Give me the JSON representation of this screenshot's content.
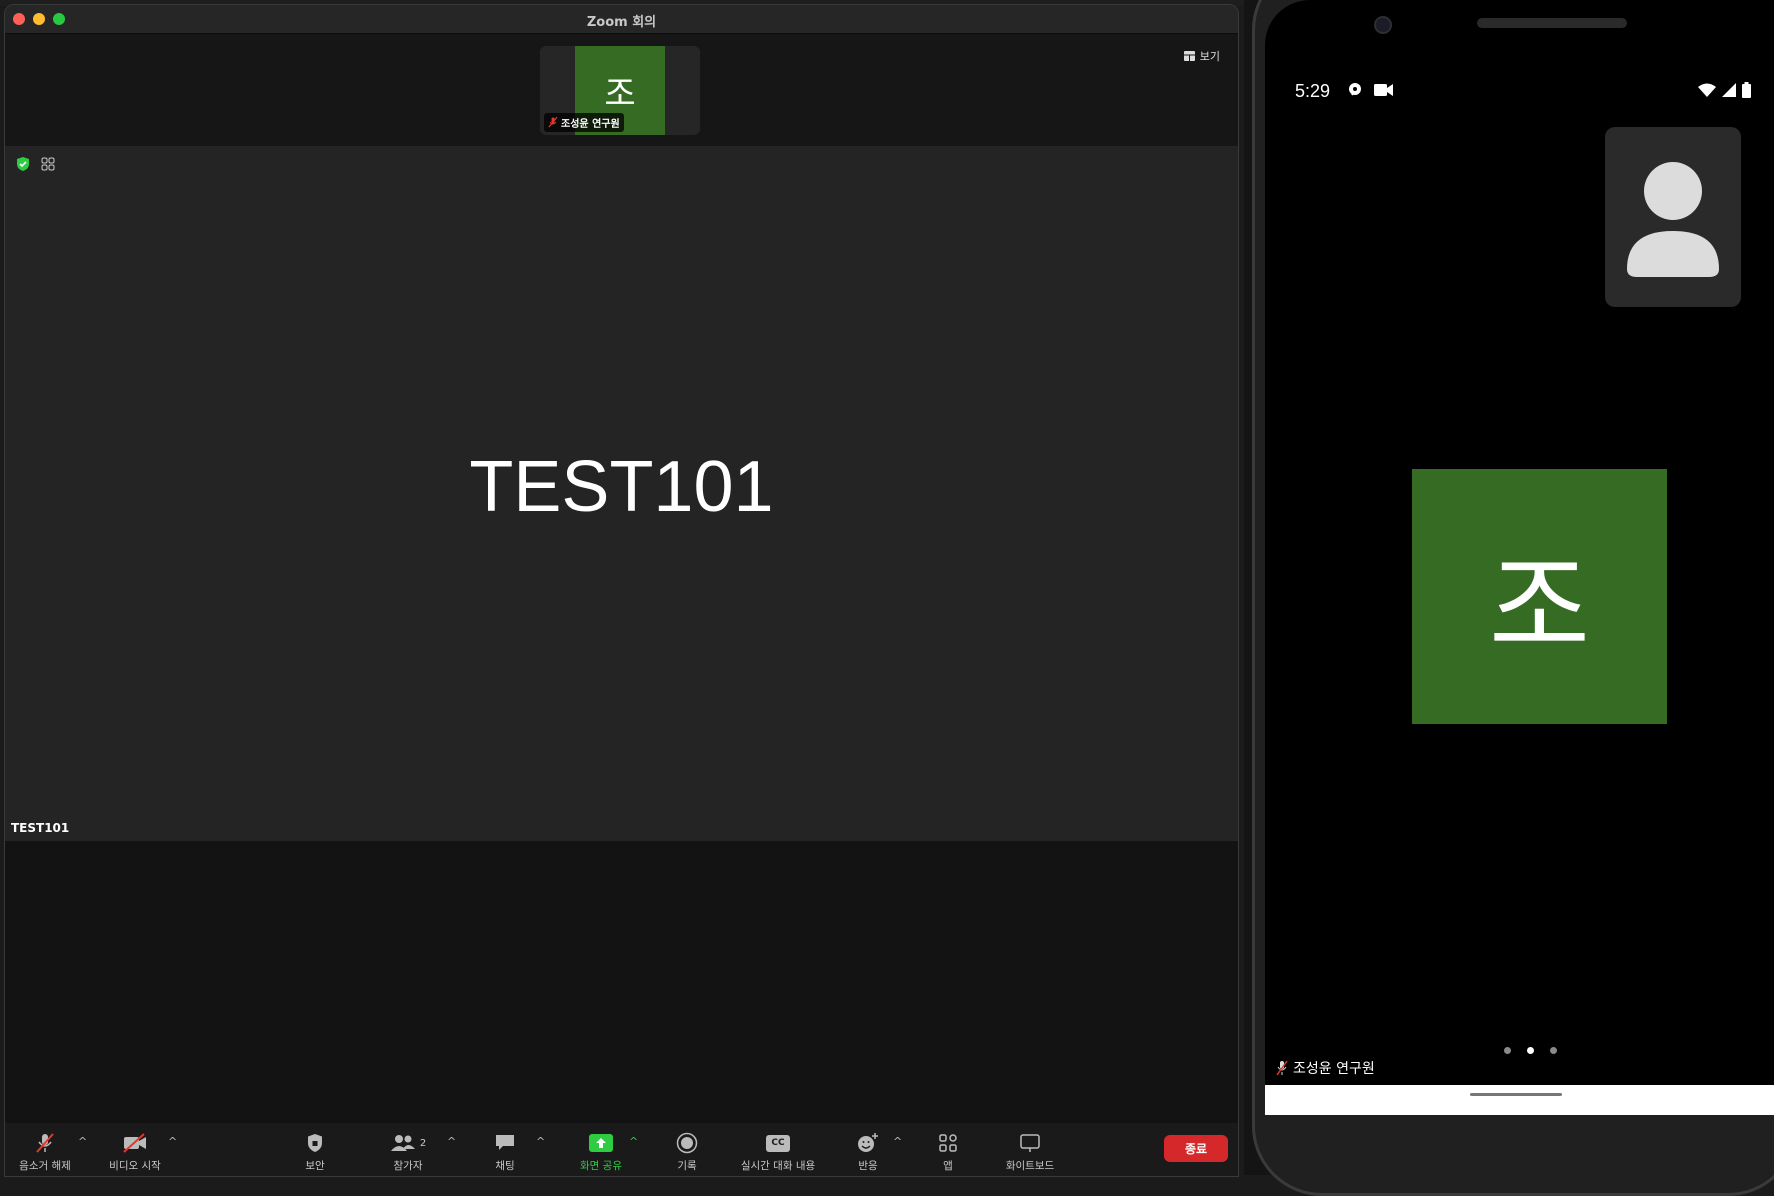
{
  "window": {
    "title": "Zoom 회의"
  },
  "strip": {
    "view_label": "보기",
    "thumbnail": {
      "initial": "조",
      "name": "조성윤 연구원"
    }
  },
  "main": {
    "name": "TEST101",
    "label": "TEST101"
  },
  "toolbar": {
    "unmute": "음소거 해제",
    "start_video": "비디오 시작",
    "security": "보안",
    "participants": "참가자",
    "participants_count": "2",
    "chat": "채팅",
    "share_screen": "화면 공유",
    "record": "기록",
    "captions": "실시간 대화 내용",
    "captions_icon_text": "CC",
    "reactions": "반응",
    "apps": "앱",
    "whiteboard": "화이트보드",
    "end": "종료"
  },
  "phone": {
    "time": "5:29",
    "avatar_initial": "조",
    "name": "조성윤 연구원",
    "page_dots": 3,
    "active_dot": 1
  },
  "colors": {
    "avatar_green": "#356b22",
    "end_red": "#d5282a",
    "share_green": "#2ecc40",
    "muted_red": "#e0392b"
  }
}
